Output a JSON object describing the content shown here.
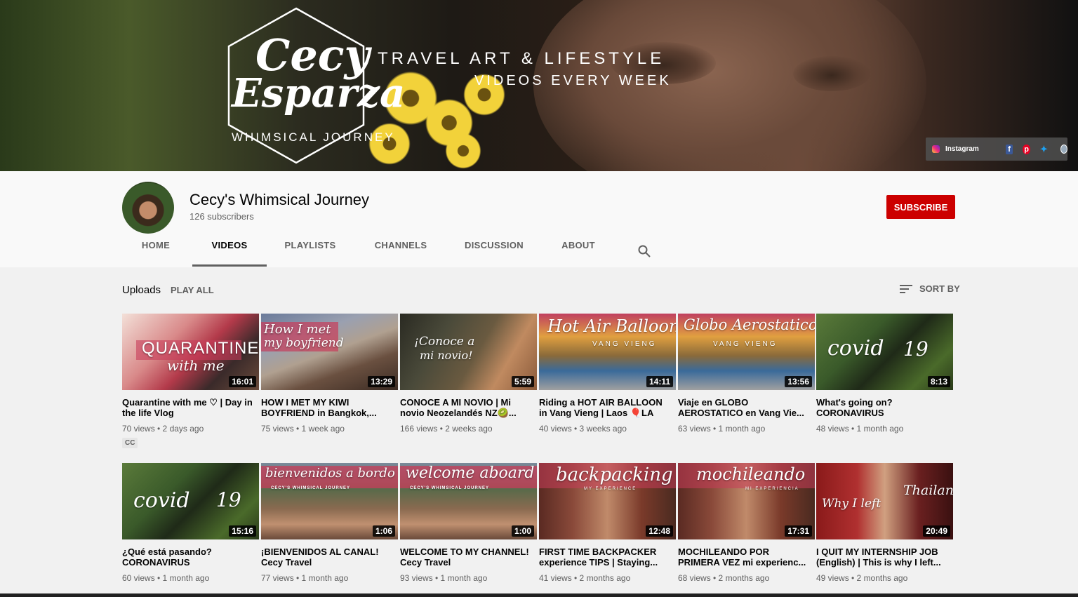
{
  "banner": {
    "logo_line1": "Cecy",
    "logo_line2": "Esparza",
    "logo_sub": "WHIMSICAL JOURNEY",
    "tagline1": "TRAVEL ART & LIFESTYLE",
    "tagline2": "VIDEOS EVERY WEEK",
    "social": {
      "instagram_label": "Instagram",
      "icons": [
        "instagram-icon",
        "facebook-icon",
        "pinterest-icon",
        "twitter-icon",
        "website-icon"
      ]
    }
  },
  "channel": {
    "name": "Cecy's Whimsical Journey",
    "subscribers": "126 subscribers",
    "subscribe_label": "SUBSCRIBE"
  },
  "tabs": [
    {
      "label": "HOME",
      "active": false
    },
    {
      "label": "VIDEOS",
      "active": true
    },
    {
      "label": "PLAYLISTS",
      "active": false
    },
    {
      "label": "CHANNELS",
      "active": false
    },
    {
      "label": "DISCUSSION",
      "active": false
    },
    {
      "label": "ABOUT",
      "active": false
    }
  ],
  "section": {
    "title": "Uploads",
    "play_all": "PLAY ALL",
    "sort_by": "SORT BY"
  },
  "videos": [
    {
      "title": "Quarantine with me ♡ | Day in the life Vlog",
      "meta": "70 views • 2 days ago",
      "duration": "16:01",
      "thumb_text": "QUARANTINE",
      "thumb_text2": "with me",
      "cc": "CC"
    },
    {
      "title": "HOW I MET MY KIWI BOYFRIEND in Bangkok,...",
      "meta": "75 views • 1 week ago",
      "duration": "13:29",
      "thumb_text": "How I met",
      "thumb_text2": "my boyfriend"
    },
    {
      "title": "CONOCE A MI NOVIO | Mi novio Neozelandés NZ🥝...",
      "meta": "166 views • 2 weeks ago",
      "duration": "5:59",
      "thumb_text": "¡Conoce a",
      "thumb_text2": "mi novio!"
    },
    {
      "title": "Riding a HOT AIR BALLOON in Vang Vieng | Laos 🎈LA",
      "meta": "40 views • 3 weeks ago",
      "duration": "14:11",
      "thumb_text": "Hot Air Balloon",
      "thumb_text2": "VANG VIENG"
    },
    {
      "title": "Viaje en GLOBO AEROSTATICO en Vang Vie...",
      "meta": "63 views • 1 month ago",
      "duration": "13:56",
      "thumb_text": "Globo Aerostatico",
      "thumb_text2": "VANG VIENG"
    },
    {
      "title": "What's going on? CORONAVIRUS",
      "meta": "48 views • 1 month ago",
      "duration": "8:13",
      "thumb_text": "covid",
      "thumb_text2": "19"
    },
    {
      "title": "¿Qué está pasando? CORONAVIRUS",
      "meta": "60 views • 1 month ago",
      "duration": "15:16",
      "thumb_text": "covid",
      "thumb_text2": "19"
    },
    {
      "title": "¡BIENVENIDOS AL CANAL! Cecy Travel",
      "meta": "77 views • 1 month ago",
      "duration": "1:06",
      "thumb_text": "bienvenidos a bordo",
      "thumb_text2": "CECY'S WHIMSICAL JOURNEY"
    },
    {
      "title": "WELCOME TO MY CHANNEL! Cecy Travel",
      "meta": "93 views • 1 month ago",
      "duration": "1:00",
      "thumb_text": "welcome aboard",
      "thumb_text2": "CECY'S WHIMSICAL JOURNEY"
    },
    {
      "title": "FIRST TIME BACKPACKER experience TIPS | Staying...",
      "meta": "41 views • 2 months ago",
      "duration": "12:48",
      "thumb_text": "backpacking",
      "thumb_text2": "MY EXPERIENCE"
    },
    {
      "title": "MOCHILEANDO POR PRIMERA VEZ mi experienc...",
      "meta": "68 views • 2 months ago",
      "duration": "17:31",
      "thumb_text": "mochileando",
      "thumb_text2": "MI EXPERIENCIA"
    },
    {
      "title": "I QUIT MY INTERNSHIP JOB (English) | This is why I left...",
      "meta": "49 views • 2 months ago",
      "duration": "20:49",
      "thumb_text": "Why I left",
      "thumb_text2": "Thailand"
    }
  ],
  "colors": {
    "subscribe_red": "#cc0000",
    "text_primary": "#030303",
    "text_secondary": "#606060",
    "page_bg": "#f9f9f9",
    "grid_bg": "#f1f1f1"
  }
}
